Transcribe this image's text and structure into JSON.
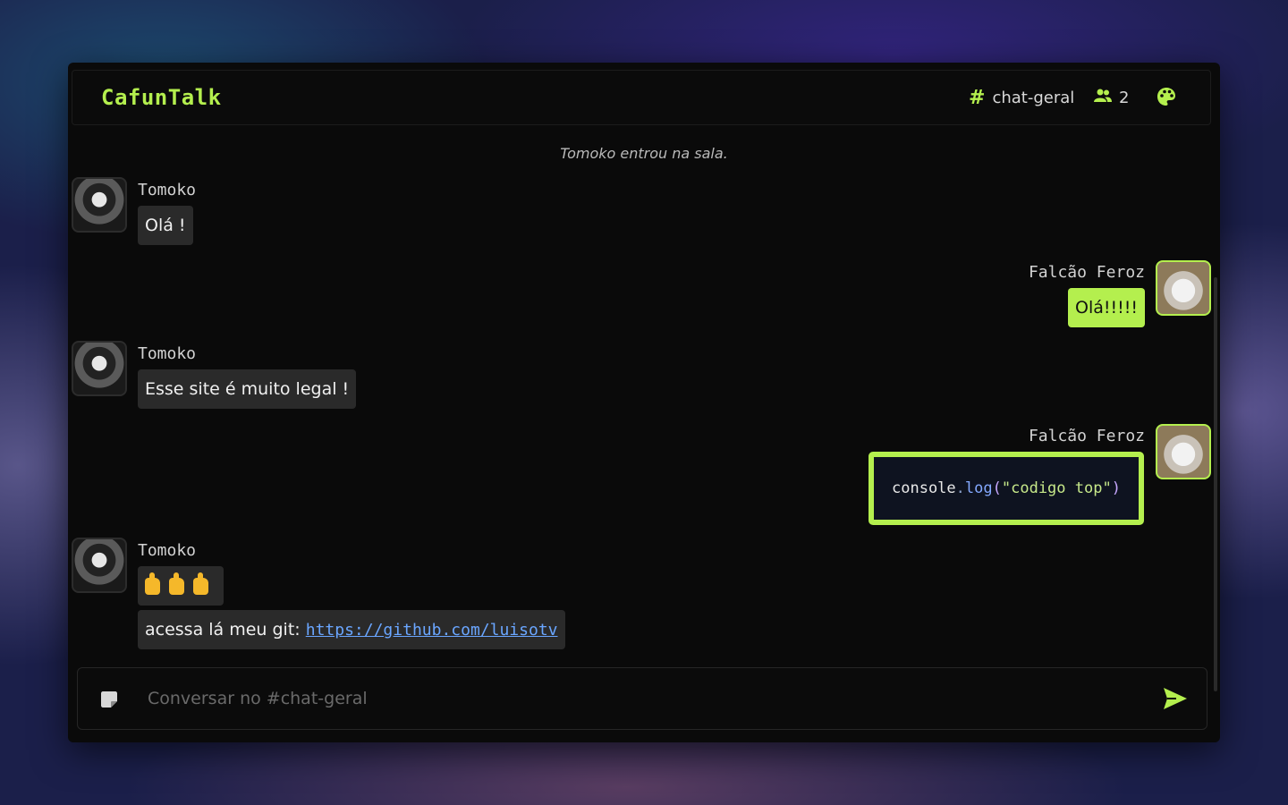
{
  "app": {
    "title": "CafunTalk"
  },
  "header": {
    "channel_symbol": "#",
    "channel_name": "chat-geral",
    "members_count": "2",
    "icons": [
      "users-icon",
      "palette-icon"
    ]
  },
  "colors": {
    "accent": "#b4ef4e",
    "bubble_other": "#2a2a2a",
    "background": "#0a0a0a"
  },
  "messages": {
    "system": "Tomoko entrou na sala.",
    "m1": {
      "user": "Tomoko",
      "text": "Olá !"
    },
    "m2": {
      "user": "Falcão Feroz",
      "text": "Olá!!!!!"
    },
    "m3": {
      "user": "Tomoko",
      "text": "Esse site é muito legal !"
    },
    "m4": {
      "user": "Falcão Feroz",
      "code": {
        "obj": "console",
        "dot": ".",
        "fn": "log",
        "open": "(",
        "str": "\"codigo top\"",
        "close": ")"
      }
    },
    "m5": {
      "user": "Tomoko",
      "emoji": "👍 👍 👍",
      "link_prefix": "acessa lá meu git: ",
      "link": "https://github.com/luisotv"
    }
  },
  "composer": {
    "placeholder": "Conversar no #chat-geral",
    "icons": [
      "sticker-icon",
      "send-icon"
    ]
  }
}
